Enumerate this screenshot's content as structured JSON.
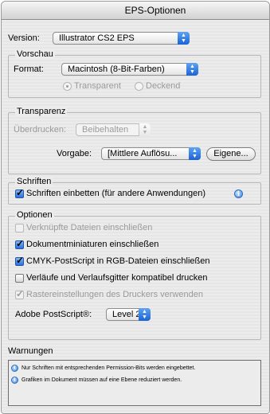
{
  "window": {
    "title": "EPS-Optionen"
  },
  "version": {
    "label": "Version:",
    "value": "Illustrator CS2 EPS"
  },
  "vorschau": {
    "legend": "Vorschau",
    "format_label": "Format:",
    "format_value": "Macintosh (8-Bit-Farben)",
    "radio_transparent": "Transparent",
    "radio_deckend": "Deckend"
  },
  "transparenz": {
    "legend": "Transparenz",
    "ueberdrucken_label": "Überdrucken:",
    "ueberdrucken_value": "Beibehalten",
    "vorgabe_label": "Vorgabe:",
    "vorgabe_value": "[Mittlere Auflösu...",
    "eigene_button": "Eigene..."
  },
  "schriften": {
    "legend": "Schriften",
    "embed_label": "Schriften einbetten (für andere Anwendungen)"
  },
  "optionen": {
    "legend": "Optionen",
    "items": [
      {
        "label": "Verknüpfte Dateien einschließen",
        "checked": false,
        "disabled": true
      },
      {
        "label": "Dokumentminiaturen einschließen",
        "checked": true,
        "disabled": false
      },
      {
        "label": "CMYK-PostScript in RGB-Dateien einschließen",
        "checked": true,
        "disabled": false
      },
      {
        "label": "Verläufe und Verlaufsgitter kompatibel drucken",
        "checked": false,
        "disabled": false
      },
      {
        "label": "Rastereinstellungen des Druckers verwenden",
        "checked": true,
        "disabled": true
      }
    ],
    "postscript_label": "Adobe PostScript®:",
    "postscript_value": "Level 2"
  },
  "warnungen": {
    "title": "Warnungen",
    "lines": [
      "Nur Schriften mit entsprechenden Permission-Bits werden eingebettet.",
      "Grafiken im Dokument müssen auf eine Ebene reduziert werden."
    ]
  },
  "icons": {
    "popup_arrows": "up-down-arrows-icon",
    "info": "info-icon",
    "accent": "#2a6fdb"
  }
}
